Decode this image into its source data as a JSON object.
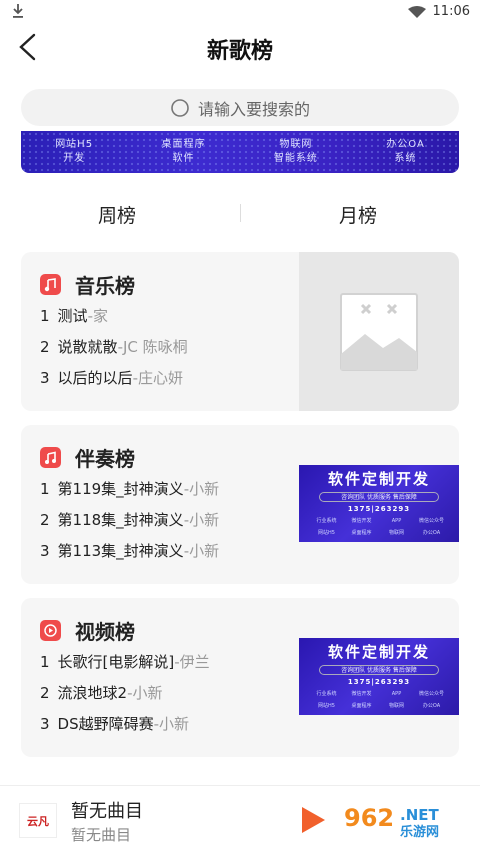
{
  "status": {
    "time": "11:06"
  },
  "nav": {
    "title": "新歌榜"
  },
  "search": {
    "placeholder": "请输入要搜索的"
  },
  "banner": {
    "items": [
      {
        "line1": "网站H5",
        "line2": "开发"
      },
      {
        "line1": "桌面程序",
        "line2": "软件"
      },
      {
        "line1": "物联网",
        "line2": "智能系统"
      },
      {
        "line1": "办公OA",
        "line2": "系统"
      }
    ]
  },
  "tabs": [
    {
      "label": "周榜"
    },
    {
      "label": "月榜"
    }
  ],
  "charts": [
    {
      "title": "音乐榜",
      "rows": [
        {
          "num": "1",
          "song": "测试",
          "artist": "-家"
        },
        {
          "num": "2",
          "song": "说散就散",
          "artist": "-JC 陈咏桐"
        },
        {
          "num": "3",
          "song": "以后的以后",
          "artist": "-庄心妍"
        }
      ]
    },
    {
      "title": "伴奏榜",
      "rows": [
        {
          "num": "1",
          "song": "第119集_封神演义",
          "artist": "-小新"
        },
        {
          "num": "2",
          "song": "第118集_封神演义",
          "artist": "-小新"
        },
        {
          "num": "3",
          "song": "第113集_封神演义",
          "artist": "-小新"
        }
      ]
    },
    {
      "title": "视频榜",
      "rows": [
        {
          "num": "1",
          "song": "长歌行[电影解说]",
          "artist": "-伊兰"
        },
        {
          "num": "2",
          "song": "流浪地球2",
          "artist": "-小新"
        },
        {
          "num": "3",
          "song": "DS越野障碍赛",
          "artist": "-小新"
        }
      ]
    }
  ],
  "promo": {
    "title": "软件定制开发",
    "subtitle": "咨询团队 优质服务 售后保障",
    "phone": "1375|263293",
    "grid": [
      "行业系统",
      "微信开发",
      "APP",
      "微信公众号",
      "网站H5",
      "桌面程序",
      "物联网",
      "办公OA"
    ]
  },
  "player": {
    "cover_text": "云凡",
    "title": "暂无曲目",
    "subtitle": "暂无曲目"
  },
  "watermark": {
    "brand": "962",
    "tld": ".NET",
    "site": "乐游网"
  },
  "colors": {
    "accent": "#ef4b4b",
    "play": "#f1602c",
    "banner": "#3a23c4"
  }
}
